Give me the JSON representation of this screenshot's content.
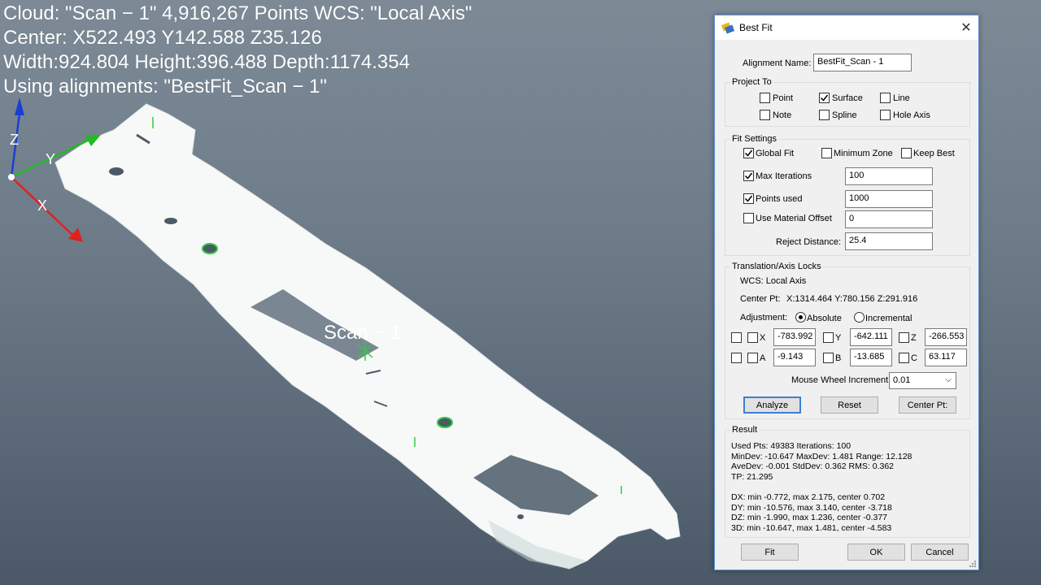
{
  "viewport": {
    "info_lines": [
      "Cloud: \"Scan − 1\" 4,916,267 Points  WCS: \"Local Axis\"",
      "Center: X522.493 Y142.588 Z35.126",
      "Width:924.804 Height:396.488 Depth:1174.354",
      "Using alignments: \"BestFit_Scan − 1\""
    ],
    "scan_label": "Scan − 1",
    "axis": {
      "x": "X",
      "y": "Y",
      "z": "Z"
    }
  },
  "dialog": {
    "title": "Best Fit",
    "alignment_name_label": "Alignment Name:",
    "alignment_name_value": "BestFit_Scan - 1",
    "project_to": {
      "label": "Project To",
      "options": [
        {
          "label": "Point",
          "checked": false
        },
        {
          "label": "Surface",
          "checked": true
        },
        {
          "label": "Line",
          "checked": false
        },
        {
          "label": "Note",
          "checked": false
        },
        {
          "label": "Spline",
          "checked": false
        },
        {
          "label": "Hole Axis",
          "checked": false
        }
      ]
    },
    "fit_settings": {
      "label": "Fit Settings",
      "global_fit": "Global Fit",
      "minimum_zone": "Minimum Zone",
      "keep_best": "Keep Best",
      "max_iterations_label": "Max Iterations",
      "max_iterations_value": "100",
      "points_used_label": "Points used",
      "points_used_value": "1000",
      "material_offset_label": "Use Material Offset",
      "material_offset_value": "0",
      "reject_distance_label": "Reject Distance:",
      "reject_distance_value": "25.4"
    },
    "locks": {
      "label": "Translation/Axis Locks",
      "wcs": "WCS:  Local Axis",
      "center_pt_label": "Center Pt:",
      "center_pt_value": "X:1314.464 Y:780.156 Z:291.916",
      "adjustment_label": "Adjustment:",
      "absolute": "Absolute",
      "incremental": "Incremental",
      "x_label": "X",
      "x_value": "-783.992",
      "y_label": "Y",
      "y_value": "-642.111",
      "z_label": "Z",
      "z_value": "-266.553",
      "a_label": "A",
      "a_value": "-9.143",
      "b_label": "B",
      "b_value": "-13.685",
      "c_label": "C",
      "c_value": "63.117",
      "mouse_wheel_label": "Mouse Wheel Increment",
      "mouse_wheel_value": "0.01",
      "analyze": "Analyze",
      "reset": "Reset",
      "center_pt_button": "Center Pt:"
    },
    "result": {
      "label": "Result",
      "lines": [
        "Used Pts: 49383 Iterations: 100",
        "MinDev: -10.647 MaxDev: 1.481 Range: 12.128",
        "AveDev: -0.001 StdDev: 0.362 RMS: 0.362",
        "TP: 21.295",
        "",
        "DX: min -0.772, max 2.175, center 0.702",
        "DY: min -10.576, max 3.140, center -3.718",
        "DZ: min -1.990, max 1.236, center -0.377",
        "3D: min -10.647, max 1.481, center -4.583"
      ]
    },
    "buttons": {
      "fit": "Fit",
      "ok": "OK",
      "cancel": "Cancel"
    }
  }
}
